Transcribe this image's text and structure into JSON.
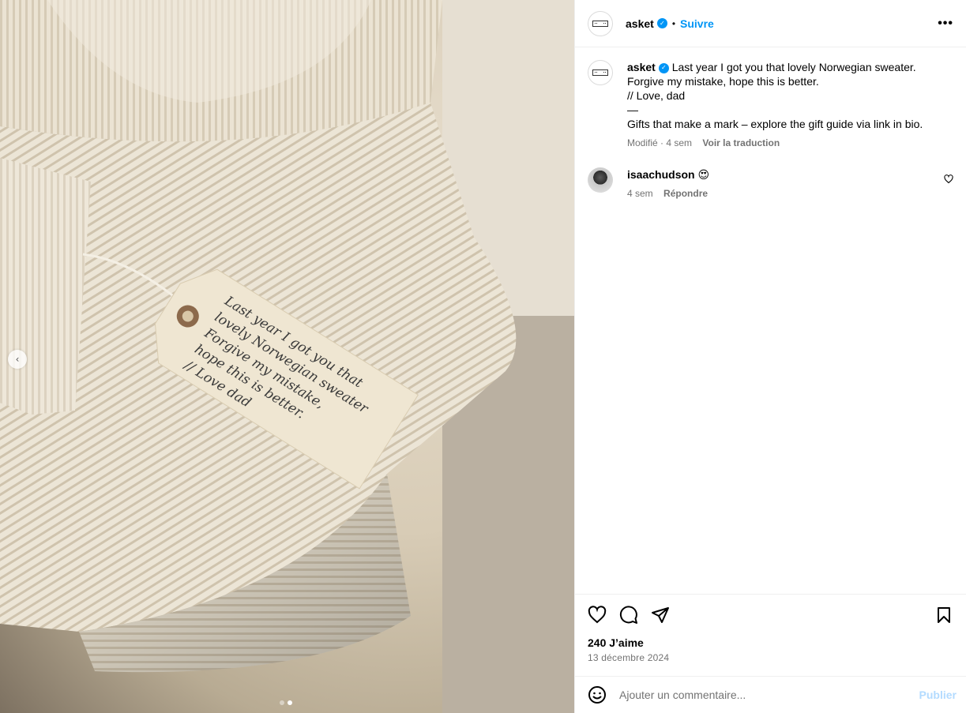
{
  "post": {
    "username": "asket",
    "follow_label": "Suivre",
    "separator": "•",
    "more_label": "•••",
    "verified_glyph": "✓"
  },
  "caption": {
    "username": "asket",
    "lines": [
      "Last year I got you that lovely Norwegian sweater.",
      "Forgive my mistake, hope this is better.",
      "// Love, dad",
      "—",
      "Gifts that make a mark – explore the gift guide via link in bio."
    ],
    "edited": "Modifié · 4 sem",
    "translate_label": "Voir la traduction"
  },
  "comments": [
    {
      "username": "isaachudson",
      "text": "😍",
      "time": "4 sem",
      "reply_label": "Répondre"
    }
  ],
  "stats": {
    "likes": "240 J’aime",
    "date": "13 décembre 2024"
  },
  "comment_box": {
    "placeholder": "Ajouter un commentaire...",
    "publish_label": "Publier"
  },
  "photo": {
    "tag_lines": [
      "Last year I got you that",
      "lovely Norwegian sweater",
      "Forgive my mistake,",
      "hope this is better.",
      "// Love dad"
    ]
  },
  "carousel": {
    "prev_glyph": "‹",
    "slide_count": 2,
    "active_index": 1
  },
  "icons": [
    "heart-icon",
    "comment-icon",
    "share-icon",
    "bookmark-icon",
    "emoji-icon",
    "more-icon",
    "verified-icon"
  ],
  "colors": {
    "accent": "#0095f6",
    "publish_disabled": "#b3dbff",
    "secondary_text": "#737373",
    "divider": "#efefef"
  }
}
